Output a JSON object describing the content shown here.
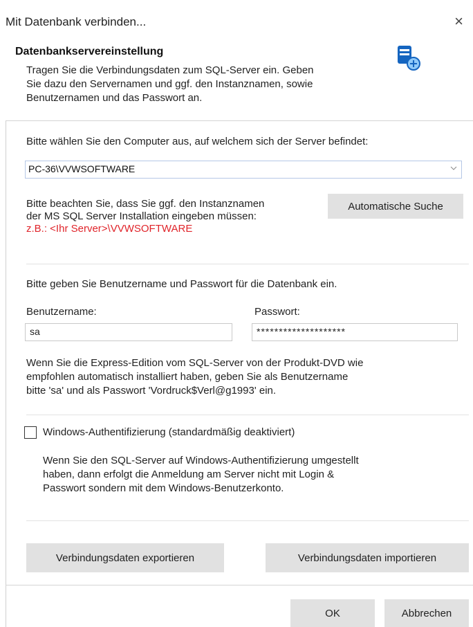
{
  "window": {
    "title": "Mit Datenbank verbinden...",
    "close_glyph": "×"
  },
  "header": {
    "title": "Datenbankservereinstellung",
    "text_lines": [
      "Tragen Sie die Verbindungsdaten zum SQL-Server ein. Geben",
      "Sie dazu den Servernamen und ggf. den Instanznamen, sowie",
      "Benutzernamen und das Passwort an."
    ],
    "icon": "database-connect-icon"
  },
  "server": {
    "prompt": "Bitte wählen Sie den Computer aus, auf welchem sich der Server befindet:",
    "selected": "PC-36\\VVWSOFTWARE",
    "note_line1": "Bitte beachten Sie, dass Sie ggf. den Instanznamen",
    "note_line2": "der MS SQL Server Installation eingeben müssen:",
    "example": "z.B.: <Ihr Server>\\VVWSOFTWARE",
    "auto_search_label": "Automatische Suche"
  },
  "credentials": {
    "prompt": "Bitte geben Sie Benutzername und Passwort für die Datenbank ein.",
    "username_label": "Benutzername:",
    "username_value": "sa",
    "password_label": "Passwort:",
    "password_value": "********************",
    "hint_lines": [
      "Wenn Sie die Express-Edition vom SQL-Server von der Produkt-DVD wie",
      "empfohlen automatisch installiert haben, geben Sie als Benutzername",
      "bitte 'sa' und als Passwort 'Vordruck$Verl@g1993' ein."
    ]
  },
  "windows_auth": {
    "label": "Windows-Authentifizierung (standardmäßig deaktiviert)",
    "checked": false,
    "hint_lines": [
      "Wenn Sie den SQL-Server auf Windows-Authentifizierung umgestellt",
      "haben, dann erfolgt die Anmeldung am Server nicht mit Login &",
      "Passwort sondern mit dem Windows-Benutzerkonto."
    ]
  },
  "actions": {
    "export_label": "Verbindungsdaten exportieren",
    "import_label": "Verbindungsdaten importieren",
    "ok_label": "OK",
    "cancel_label": "Abbrechen"
  },
  "colors": {
    "accent_red": "#e0242a",
    "button_bg": "#e1e1e1",
    "icon_blue": "#1565c0"
  }
}
